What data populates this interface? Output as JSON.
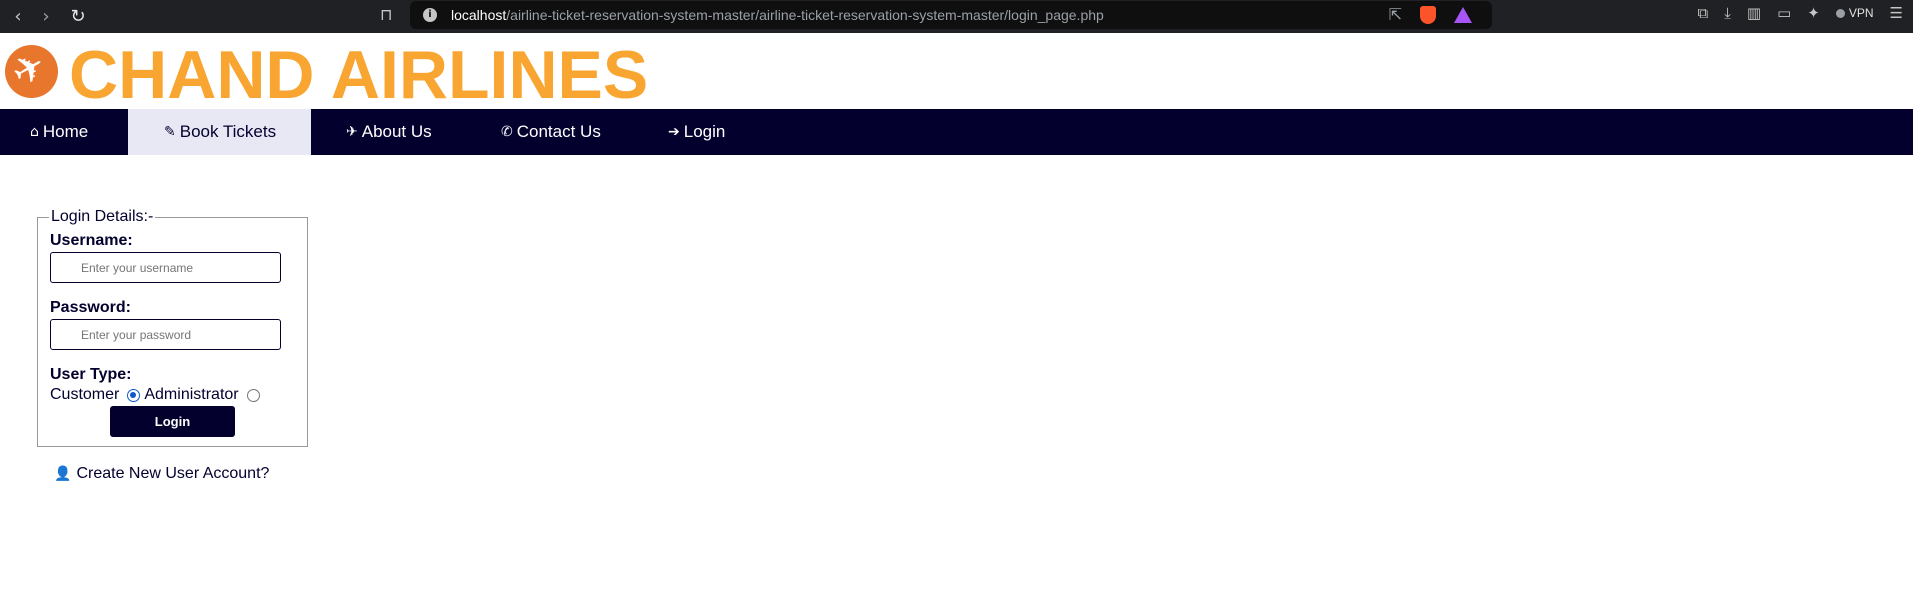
{
  "browser": {
    "url_host": "localhost",
    "url_path": "/airline-ticket-reservation-system-master/airline-ticket-reservation-system-master/login_page.php",
    "vpn_label": "VPN"
  },
  "header": {
    "brand": "CHAND AIRLINES"
  },
  "nav": {
    "items": [
      {
        "label": "Home",
        "icon": "home-icon"
      },
      {
        "label": "Book Tickets",
        "icon": "ticket-icon"
      },
      {
        "label": "About Us",
        "icon": "plane-icon"
      },
      {
        "label": "Contact Us",
        "icon": "phone-icon"
      },
      {
        "label": "Login",
        "icon": "sign-in-icon"
      }
    ]
  },
  "login": {
    "legend": "Login Details:-",
    "username_label": "Username:",
    "username_placeholder": "Enter your username",
    "password_label": "Password:",
    "password_placeholder": "Enter your password",
    "user_type_label": "User Type:",
    "option_customer": "Customer",
    "option_admin": "Administrator",
    "selected_option": "Customer",
    "submit_label": "Login"
  },
  "create_account": {
    "label": "Create New User Account?"
  },
  "colors": {
    "brand": "#f8a532",
    "navbar": "#03002e",
    "active_tab": "#e8e8f5",
    "logo": "#e8762d"
  }
}
